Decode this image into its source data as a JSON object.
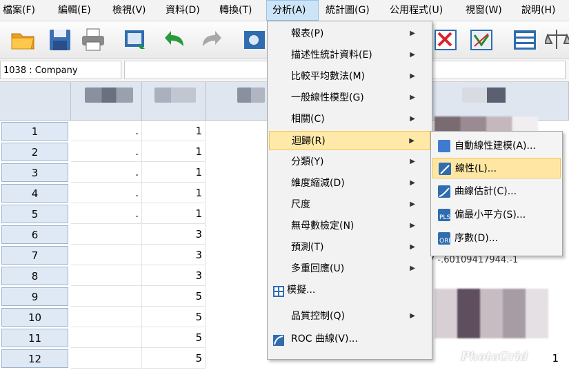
{
  "menubar": {
    "items": [
      {
        "label": "檔案(F)"
      },
      {
        "label": "編輯(E)"
      },
      {
        "label": "檢視(V)"
      },
      {
        "label": "資料(D)"
      },
      {
        "label": "轉換(T)"
      },
      {
        "label": "分析(A)"
      },
      {
        "label": "統計圖(G)"
      },
      {
        "label": "公用程式(U)"
      },
      {
        "label": "視窗(W)"
      },
      {
        "label": "說明(H)"
      }
    ]
  },
  "cellbar": {
    "ref": "1038 : Company"
  },
  "rows": [
    {
      "n": "1",
      "dot": ".",
      "v": "1"
    },
    {
      "n": "2",
      "dot": ".",
      "v": "1"
    },
    {
      "n": "3",
      "dot": ".",
      "v": "1"
    },
    {
      "n": "4",
      "dot": ".",
      "v": "1"
    },
    {
      "n": "5",
      "dot": ".",
      "v": "1"
    },
    {
      "n": "6",
      "dot": "",
      "v": "3"
    },
    {
      "n": "7",
      "dot": "",
      "v": "3"
    },
    {
      "n": "8",
      "dot": "",
      "v": "3"
    },
    {
      "n": "9",
      "dot": "",
      "v": "5"
    },
    {
      "n": "10",
      "dot": "",
      "v": "5"
    },
    {
      "n": "11",
      "dot": "",
      "v": "5"
    },
    {
      "n": "12",
      "dot": "",
      "v": "5"
    }
  ],
  "analyze_menu": {
    "items": [
      {
        "label": "報表(P)",
        "arrow": "▶"
      },
      {
        "label": "描述性統計資料(E)",
        "arrow": "▶"
      },
      {
        "label": "比較平均數法(M)",
        "arrow": "▶"
      },
      {
        "label": "一般線性模型(G)",
        "arrow": "▶"
      },
      {
        "label": "相關(C)",
        "arrow": "▶"
      },
      {
        "label": "迴歸(R)",
        "arrow": "▶"
      },
      {
        "label": "分類(Y)",
        "arrow": "▶"
      },
      {
        "label": "維度縮減(D)",
        "arrow": "▶"
      },
      {
        "label": "尺度",
        "arrow": "▶"
      },
      {
        "label": "無母數檢定(N)",
        "arrow": "▶"
      },
      {
        "label": "預測(T)",
        "arrow": "▶"
      },
      {
        "label": "多重回應(U)",
        "arrow": "▶"
      },
      {
        "label": "模擬...",
        "arrow": ""
      },
      {
        "label": "品質控制(Q)",
        "arrow": "▶"
      },
      {
        "label": "ROC 曲線(V)...",
        "arrow": ""
      }
    ]
  },
  "regression_submenu": {
    "items": [
      {
        "label": "自動線性建模(A)..."
      },
      {
        "label": "線性(L)..."
      },
      {
        "label": "曲線估計(C)..."
      },
      {
        "label": "偏最小平方(S)..."
      },
      {
        "label": "序數(D)..."
      }
    ]
  },
  "partial_cell_text": "7 -.60109417944.-1",
  "last_row_partial": "1",
  "watermark": "PhotoGrid",
  "colors": {
    "highlight": "#ffe9a8",
    "menu_active": "#cce4f7",
    "rowhead": "#dfe9f5"
  }
}
